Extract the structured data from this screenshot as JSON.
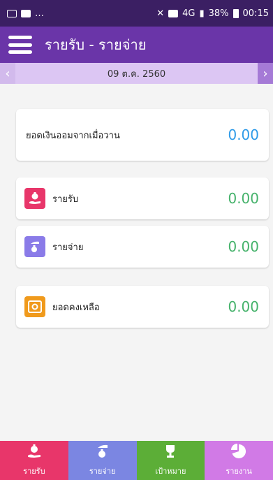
{
  "status_bar": {
    "left_dots": "…",
    "battery_percent": "38%",
    "time": "00:15",
    "network": "4G"
  },
  "app_bar": {
    "title": "รายรับ - รายจ่าย"
  },
  "date_bar": {
    "date": "09 ต.ค. 2560",
    "prev_icon": "chevron-left-icon",
    "next_icon": "chevron-right-icon"
  },
  "balance": {
    "label": "ยอดเงินออมจากเมื่อวาน",
    "value": "0.00",
    "color": "#2f9be8"
  },
  "rows": [
    {
      "label": "รายรับ",
      "value": "0.00",
      "icon": "money-bag-hand-icon",
      "color": "#e8366a"
    },
    {
      "label": "รายจ่าย",
      "value": "0.00",
      "icon": "money-bag-out-icon",
      "color": "#8a7be8"
    },
    {
      "label": "ยอดคงเหลือ",
      "value": "0.00",
      "icon": "safe-icon",
      "color": "#f09a1c"
    }
  ],
  "bottom_nav": [
    {
      "label": "รายรับ",
      "icon": "money-bag-hand-icon",
      "color": "#e8366a"
    },
    {
      "label": "รายจ่าย",
      "icon": "money-bag-out-icon",
      "color": "#7b86e2"
    },
    {
      "label": "เป้าหมาย",
      "icon": "trophy-icon",
      "color": "#5cae37"
    },
    {
      "label": "รายงาน",
      "icon": "pie-chart-icon",
      "color": "#d17ae6"
    }
  ],
  "colors": {
    "status_bar": "#3b1f63",
    "app_bar": "#6a35a8",
    "date_bar": "#dcc6f3",
    "value_green": "#45b26b"
  }
}
